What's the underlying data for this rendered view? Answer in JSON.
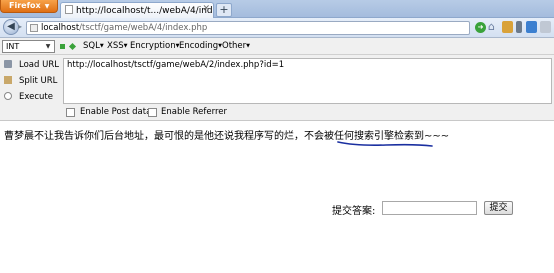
{
  "browser": {
    "app_button": "Firefox",
    "tab_title": "http://localhost/t.../webA/4/index.php",
    "new_tab": "+",
    "url_host": "localhost",
    "url_path": "/tsctf/game/webA/4/index.php"
  },
  "hackbar": {
    "encoding_select": "INT",
    "menus": [
      "SQL",
      "XSS",
      "Encryption",
      "Encoding",
      "Other"
    ],
    "buttons": [
      "Load URL",
      "Split URL",
      "Execute"
    ],
    "url_value": "http://localhost/tsctf/game/webA/2/index.php?id=1",
    "post_label": "Enable Post data",
    "referrer_label": "Enable Referrer"
  },
  "page": {
    "message": "曹梦晨不让我告诉你们后台地址，最可恨的是他还说我程序写的烂，不会被任何搜索引擎检索到~~~",
    "answer_label": "提交答案:",
    "answer_value": "",
    "submit_label": "提交"
  },
  "colors": {
    "firefox_orange": "#e07014",
    "annotation_underline": "#1a2fa0"
  }
}
